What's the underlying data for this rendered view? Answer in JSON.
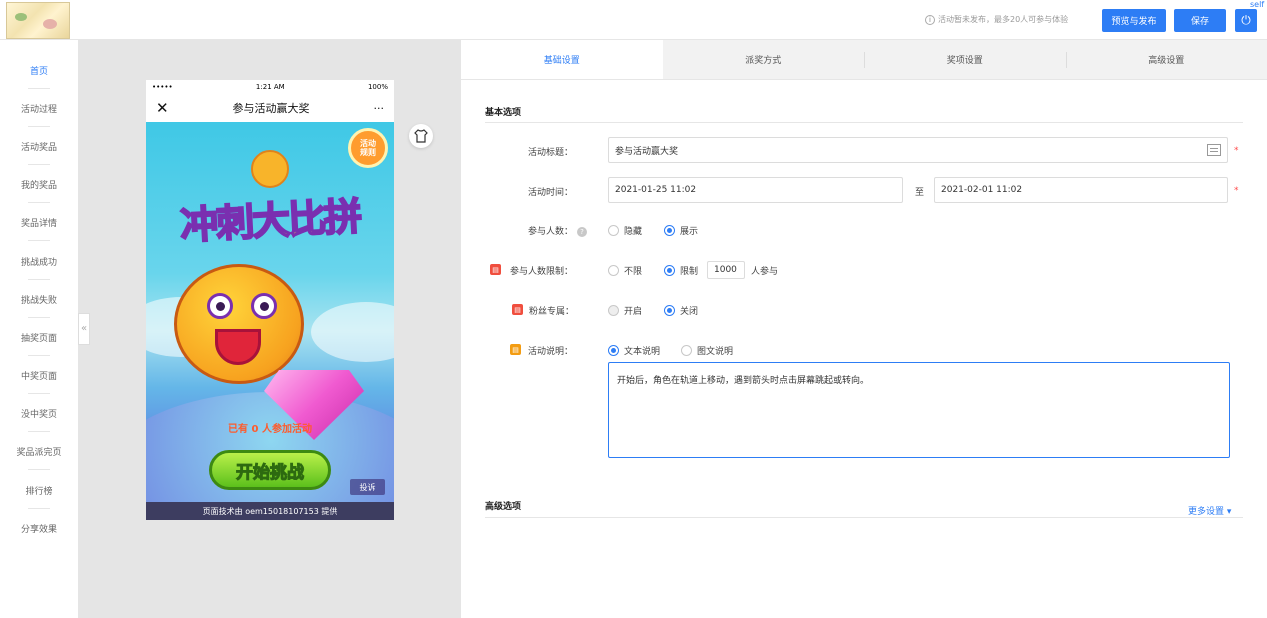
{
  "header": {
    "notice": "活动暂未发布，最多20人可参与体验",
    "preview_publish": "预览与发布",
    "save": "保存",
    "self_link": "self",
    "power_icon": "power-icon"
  },
  "sidebar": {
    "items": [
      "首页",
      "活动过程",
      "活动奖品",
      "我的奖品",
      "奖品详情",
      "挑战成功",
      "挑战失败",
      "抽奖页面",
      "中奖页面",
      "没中奖页",
      "奖品派完页",
      "排行榜",
      "分享效果"
    ],
    "active_index": 0,
    "collapse_glyph": "«"
  },
  "phone": {
    "signal": "•••••",
    "time": "1:21 AM",
    "battery": "100%",
    "close_glyph": "✕",
    "title": "参与活动赢大奖",
    "more_glyph": "···",
    "game": {
      "title_art": "冲刺大比拼",
      "rule_badge": "活动\n规则",
      "joined_text": "已有 0 人参加活动",
      "start_button": "开始挑战",
      "complaint": "投诉"
    },
    "footer": "页面技术由 oem15018107153 提供"
  },
  "tabs": [
    "基础设置",
    "派奖方式",
    "奖项设置",
    "高级设置"
  ],
  "active_tab": 0,
  "basic": {
    "section_title": "基本选项",
    "title_label": "活动标题：",
    "title_value": "参与活动赢大奖",
    "time_label": "活动时间：",
    "start_time": "2021-01-25 11:02",
    "to": "至",
    "end_time": "2021-02-01 11:02",
    "count_label": "参与人数：",
    "count_hide": "隐藏",
    "count_show": "展示",
    "limit_label": "参与人数限制：",
    "limit_none": "不限",
    "limit_on": "限制",
    "limit_value": "1000",
    "limit_suffix": "人参与",
    "fans_label": "粉丝专属：",
    "fans_on": "开启",
    "fans_off": "关闭",
    "desc_label": "活动说明：",
    "desc_text": "文本说明",
    "desc_rich": "图文说明",
    "desc_value": "开始后，角色在轨道上移动，遇到箭头时点击屏幕跳起或转向。",
    "required": "*"
  },
  "advanced": {
    "section_title": "高级选项",
    "more_settings": "更多设置 ▾"
  },
  "colors": {
    "accent": "#2d7df5",
    "required": "#ff4a4a",
    "tag_red": "#f04e3e",
    "tag_orange": "#f39c12"
  }
}
